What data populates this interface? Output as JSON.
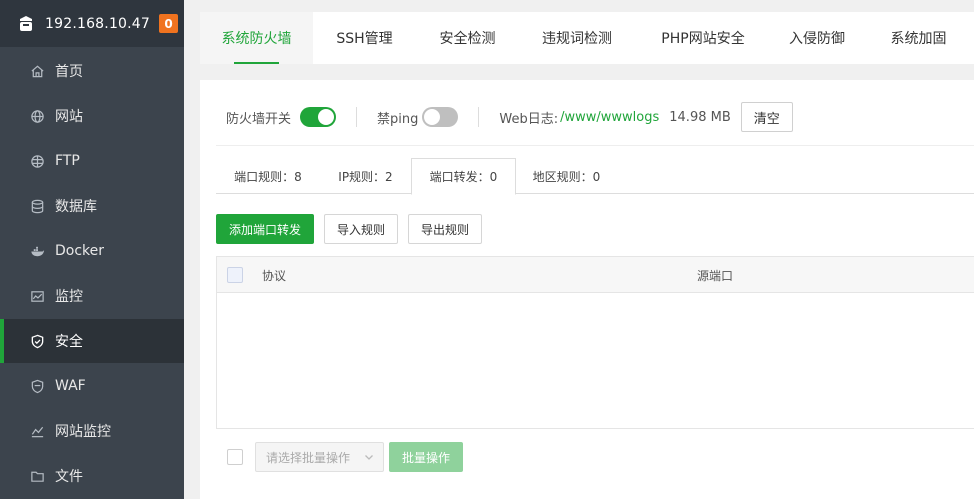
{
  "sidebar": {
    "host_ip": "192.168.10.47",
    "notification_count": "0",
    "items": [
      {
        "label": "首页",
        "icon": "home-icon"
      },
      {
        "label": "网站",
        "icon": "globe-icon"
      },
      {
        "label": "FTP",
        "icon": "ftp-globe-icon"
      },
      {
        "label": "数据库",
        "icon": "database-icon"
      },
      {
        "label": "Docker",
        "icon": "docker-icon"
      },
      {
        "label": "监控",
        "icon": "monitor-chart-icon"
      },
      {
        "label": "安全",
        "icon": "shield-check-icon",
        "active": true
      },
      {
        "label": "WAF",
        "icon": "waf-shield-icon"
      },
      {
        "label": "网站监控",
        "icon": "line-chart-icon"
      },
      {
        "label": "文件",
        "icon": "folder-icon"
      }
    ]
  },
  "top_tabs": [
    "系统防火墙",
    "SSH管理",
    "安全检测",
    "违规词检测",
    "PHP网站安全",
    "入侵防御",
    "系统加固"
  ],
  "active_top_tab": "系统防火墙",
  "toolbar": {
    "firewall_label": "防火墙开关",
    "firewall_on": true,
    "ping_label": "禁ping",
    "ping_on": false,
    "web_log_label": "Web日志:",
    "web_log_path": "/www/wwwlogs",
    "web_log_size": "14.98 MB",
    "clear_label": "清空"
  },
  "sub_tabs": [
    "端口规则：8",
    "IP规则：2",
    "端口转发：0",
    "地区规则：0"
  ],
  "active_sub_tab": "端口转发：0",
  "actions": {
    "add_forward": "添加端口转发",
    "import_rules": "导入规则",
    "export_rules": "导出规则"
  },
  "table": {
    "columns": [
      "协议",
      "源端口"
    ],
    "rows": []
  },
  "batch": {
    "select_placeholder": "请选择批量操作",
    "button_label": "批量操作"
  },
  "colors": {
    "accent": "#20a53a",
    "sidebar_bg": "#3c444d",
    "badge": "#f0731f"
  }
}
